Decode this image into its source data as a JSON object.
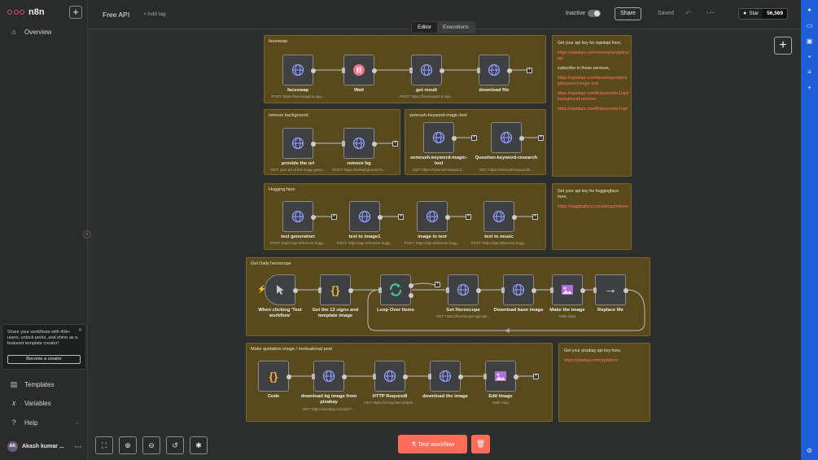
{
  "app": {
    "logo_text": "n8n"
  },
  "sidebar": {
    "overview": "Overview",
    "templates": "Templates",
    "variables": "Variables",
    "help": "Help",
    "promo_text": "Share your workflows with 40k+ users, unlock perks, and shine as a featured template creator!",
    "promo_cta": "Become a creator",
    "user_initials": "AK",
    "user_name": "Akash kumar ..."
  },
  "header": {
    "workflow_name": "Free API",
    "add_tag": "+ Add tag",
    "status": "Inactive",
    "share": "Share",
    "saved": "Saved",
    "github_star": "Star",
    "github_count": "56,569"
  },
  "tabs": {
    "editor": "Editor",
    "executions": "Executions"
  },
  "stickies": {
    "faceswap": "faceswap",
    "remove_bg": "remove background",
    "semrush": "semrush-keyword-magic-tool",
    "hugging": "Hugging face",
    "horoscope": "Get Daily horoscope",
    "quotation": "Make quotation image / motivational post"
  },
  "notes": {
    "rapidapi_intro": "Get your api key for rapidapi here,",
    "rapidapi_link": "https://rapidapi.com/console/analytics/api",
    "subscribe": "subscribe to these services,",
    "svc1": "https://rapidapi.com/bairamkaroddy/api/keyword-magic-tool",
    "svc2": "https://rapidapi.com/firdavscoder1/api/background-remover",
    "svc3": "https://rapidapi.com/firdavscoder1/api",
    "hf_intro": "Get your api key for huggingface here,",
    "hf_link": "https://huggingface.co/settings/tokens",
    "pixabay_intro": "Get your pixabay api key here,",
    "pixabay_link": "https://pixabay.com/api/docs/"
  },
  "nodes": {
    "faceswap": "faceswap",
    "faceswap_sub": "POST: https://faceswap3.p.rapi...",
    "wait": "Wait",
    "get_result": "get result",
    "get_result_sub": "POST: https://faceswap3.p.rapi...",
    "download_file": "download file",
    "provide_url": "provide the url",
    "provide_url_sub": "GET: your url of the image goes...",
    "remove_bg": "remove bg",
    "remove_bg_sub": "POST: https://ai-background-re...",
    "semrush_tool": "semrush-keyword-magic-tool",
    "semrush_tool_sub": "GET: https://semrush-keyword...",
    "question_kw": "Question-keyword-research",
    "question_kw_sub": "GET: https://semrush-keywords...",
    "text_gen": "text generation",
    "text_gen_sub": "POST: https://api-inference.hugg...",
    "text_img": "text to image1",
    "text_img_sub": "POST: https://api-inference.hugg...",
    "img_text": "image to text",
    "img_text_sub": "POST: https://api-inference.hugg...",
    "text_music": "text to music",
    "text_music_sub": "POST: https://api-inference.hugg...",
    "trigger": "When clicking 'Test workflow'",
    "signs": "Get the 12 signs and template image",
    "loop": "Loop Over Items",
    "horoscope": "Get Horoscope",
    "horoscope_sub": "GET: https://horoscope-app-api...",
    "download_base": "Download base image",
    "make_image": "Make the image",
    "make_image_sub": "Multi Step",
    "replace": "Replace Me",
    "code": "Code",
    "download_bg": "download bg image from pixabay",
    "download_bg_sub": "GET: https://pixabay.com/api/?...",
    "http8": "HTTP Request8",
    "http8_sub": "GET: https://zenquotes.io/api/r...",
    "download_img": "download the image",
    "edit_image": "Edit Image",
    "edit_image_sub": "Multi Step"
  },
  "toolbar": {
    "test": "Test workflow"
  },
  "colors": {
    "accent": "#ff6d5a",
    "sticky": "#584a1d",
    "rail": "#1f5ed8",
    "link": "#ff7a5a"
  }
}
